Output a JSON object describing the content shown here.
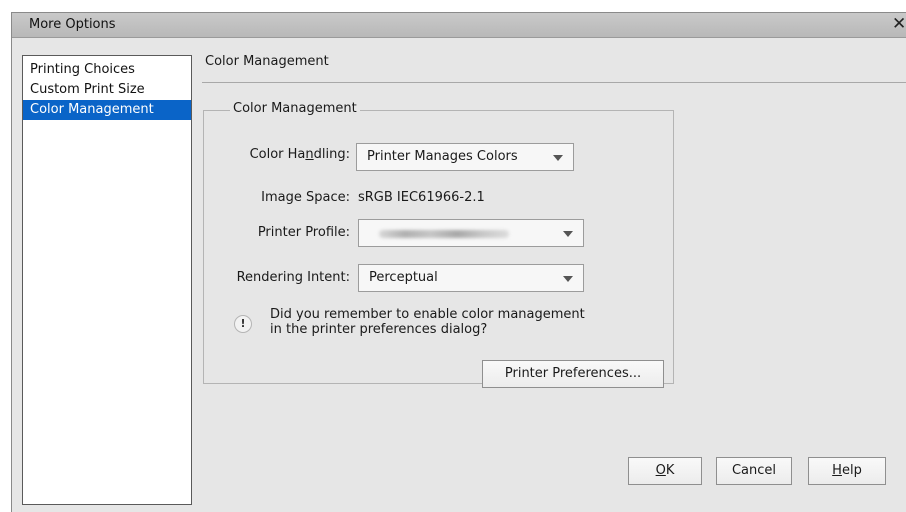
{
  "window": {
    "title": "More Options",
    "close_glyph": "✕"
  },
  "sidebar": {
    "items": [
      {
        "label": "Printing Choices",
        "selected": false
      },
      {
        "label": "Custom Print Size",
        "selected": false
      },
      {
        "label": "Color Management",
        "selected": true
      }
    ]
  },
  "main": {
    "section_title": "Color Management",
    "group_title": "Color Management",
    "color_handling": {
      "label_pre": "Color Ha",
      "label_accel": "n",
      "label_post": "dling:",
      "value": "Printer Manages Colors"
    },
    "image_space": {
      "label": "Image Space:",
      "value": "sRGB IEC61966-2.1"
    },
    "printer_profile": {
      "label": "Printer Profile:",
      "value_redacted": true
    },
    "rendering_intent": {
      "label": "Rendering Intent:",
      "value": "Perceptual"
    },
    "warning": {
      "icon": "exclamation-icon",
      "line1": "Did you remember to enable color management",
      "line2": "in the printer preferences dialog?"
    },
    "printer_preferences_button": "Printer Preferences..."
  },
  "footer": {
    "ok": {
      "accel": "O",
      "rest": "K"
    },
    "cancel": "Cancel",
    "help": {
      "accel": "H",
      "rest": "elp"
    }
  },
  "colors": {
    "selection": "#0a64c8",
    "window_bg": "#e6e6e6"
  }
}
